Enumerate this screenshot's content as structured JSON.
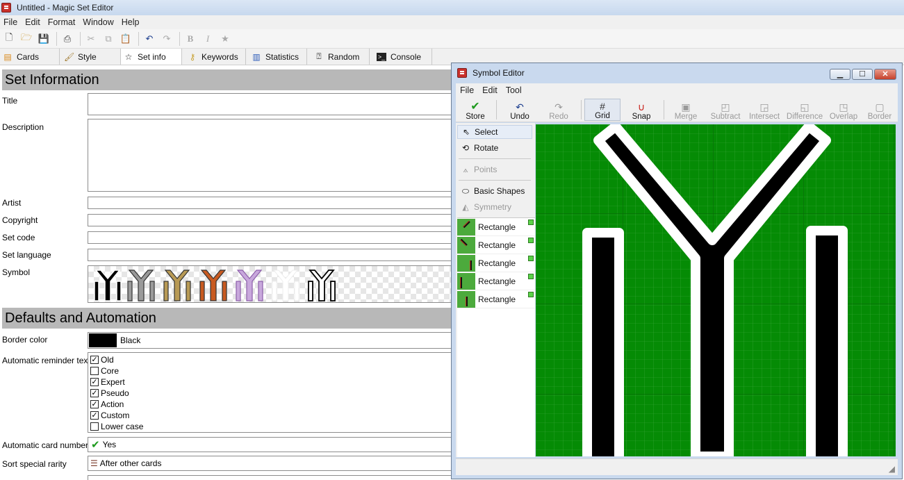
{
  "window": {
    "title": "Untitled - Magic Set Editor"
  },
  "menubar": [
    "File",
    "Edit",
    "Format",
    "Window",
    "Help"
  ],
  "tabs": [
    {
      "label": "Cards",
      "icon": "cards-icon"
    },
    {
      "label": "Style",
      "icon": "style-brush-icon"
    },
    {
      "label": "Set info",
      "icon": "star-icon"
    },
    {
      "label": "Keywords",
      "icon": "key-icon"
    },
    {
      "label": "Statistics",
      "icon": "bar-chart-icon"
    },
    {
      "label": "Random",
      "icon": "random-card-icon"
    },
    {
      "label": "Console",
      "icon": "console-icon"
    }
  ],
  "active_tab": "Set info",
  "set_info": {
    "header": "Set Information",
    "fields": {
      "title": {
        "label": "Title",
        "value": ""
      },
      "description": {
        "label": "Description",
        "value": ""
      },
      "artist": {
        "label": "Artist",
        "value": ""
      },
      "copyright": {
        "label": "Copyright",
        "value": ""
      },
      "set_code": {
        "label": "Set code",
        "value": ""
      },
      "set_language": {
        "label": "Set language",
        "value": ""
      },
      "symbol": {
        "label": "Symbol"
      }
    }
  },
  "defaults": {
    "header": "Defaults and Automation",
    "border_color": {
      "label": "Border color",
      "value": "Black",
      "swatch": "#000000"
    },
    "reminder": {
      "label": "Automatic reminder text",
      "options": [
        {
          "label": "Old",
          "checked": true
        },
        {
          "label": "Core",
          "checked": false
        },
        {
          "label": "Expert",
          "checked": true
        },
        {
          "label": "Pseudo",
          "checked": true
        },
        {
          "label": "Action",
          "checked": true
        },
        {
          "label": "Custom",
          "checked": true
        },
        {
          "label": "Lower case",
          "checked": false
        }
      ]
    },
    "card_numbers": {
      "label": "Automatic card numbers",
      "value": "Yes"
    },
    "sort_rarity": {
      "label": "Sort special rarity",
      "value": "After other cards"
    }
  },
  "symbol_editor": {
    "title": "Symbol Editor",
    "menu": [
      "File",
      "Edit",
      "Tool"
    ],
    "toolbar": [
      {
        "label": "Store",
        "icon": "checkmark-icon",
        "enabled": true
      },
      {
        "label": "Undo",
        "icon": "undo-icon",
        "enabled": true
      },
      {
        "label": "Redo",
        "icon": "redo-icon",
        "enabled": false
      },
      {
        "label": "Grid",
        "icon": "grid-icon",
        "enabled": true,
        "pressed": true
      },
      {
        "label": "Snap",
        "icon": "magnet-icon",
        "enabled": true
      },
      {
        "label": "Merge",
        "icon": "merge-icon",
        "enabled": false
      },
      {
        "label": "Subtract",
        "icon": "subtract-icon",
        "enabled": false
      },
      {
        "label": "Intersect",
        "icon": "intersect-icon",
        "enabled": false
      },
      {
        "label": "Difference",
        "icon": "difference-icon",
        "enabled": false
      },
      {
        "label": "Overlap",
        "icon": "overlap-icon",
        "enabled": false
      },
      {
        "label": "Border",
        "icon": "border-icon",
        "enabled": false
      }
    ],
    "tools": [
      {
        "label": "Select",
        "icon": "cursor-icon",
        "selected": true,
        "enabled": true
      },
      {
        "label": "Rotate",
        "icon": "rotate-icon",
        "enabled": true
      },
      {
        "label": "Points",
        "icon": "points-icon",
        "enabled": false
      },
      {
        "label": "Basic Shapes",
        "icon": "ellipse-icon",
        "enabled": true
      },
      {
        "label": "Symmetry",
        "icon": "symmetry-icon",
        "enabled": false
      }
    ],
    "parts": [
      "Rectangle",
      "Rectangle",
      "Rectangle",
      "Rectangle",
      "Rectangle"
    ],
    "canvas": {
      "background": "#058b05",
      "grid": true
    }
  }
}
